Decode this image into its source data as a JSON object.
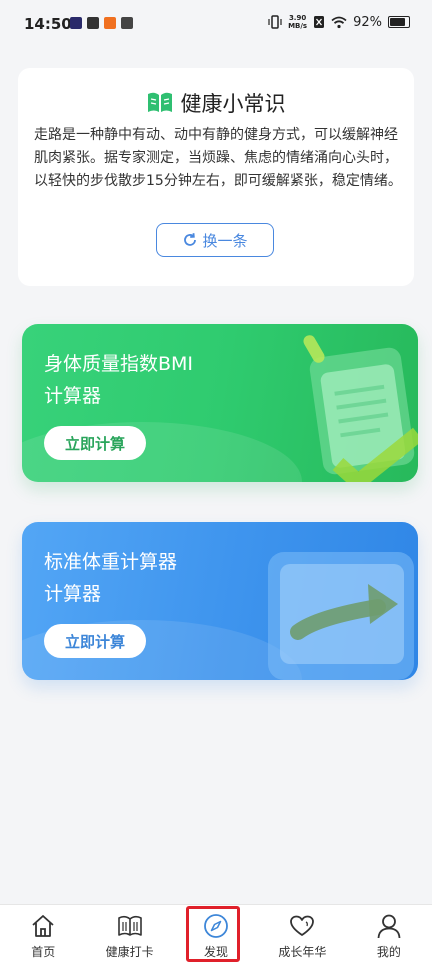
{
  "status_bar": {
    "time": "14:50",
    "net_speed_value": "3.90",
    "net_speed_unit": "MB/s",
    "battery": "92%"
  },
  "tip": {
    "title": "健康小常识",
    "icon": "book-icon",
    "body": "走路是一种静中有动、动中有静的健身方式，可以缓解神经肌肉紧张。据专家测定，当烦躁、焦虑的情绪涌向心头时，以轻快的步伐散步15分钟左右，即可缓解紧张，稳定情绪。",
    "refresh_label": "换一条",
    "accent": "#4a88df"
  },
  "cards": [
    {
      "title_line1": "身体质量指数BMI",
      "title_line2": "计算器",
      "button": "立即计算",
      "color": "#2fcb6f"
    },
    {
      "title_line1": "标准体重计算器",
      "title_line2": "计算器",
      "button": "立即计算",
      "color": "#3f95ee"
    }
  ],
  "nav": {
    "items": [
      {
        "label": "首页",
        "icon": "home-icon"
      },
      {
        "label": "健康打卡",
        "icon": "book-icon"
      },
      {
        "label": "发现",
        "icon": "compass-icon",
        "active": true
      },
      {
        "label": "成长年华",
        "icon": "heart-icon"
      },
      {
        "label": "我的",
        "icon": "user-icon"
      }
    ]
  }
}
